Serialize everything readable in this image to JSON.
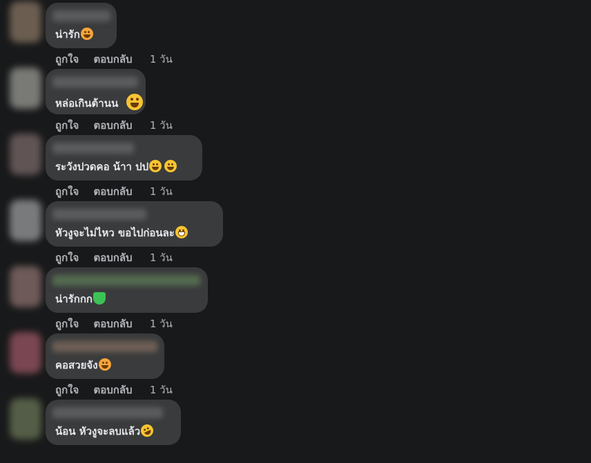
{
  "actions": {
    "like": "ถูกใจ",
    "reply": "ตอบกลับ"
  },
  "comments": [
    {
      "text": "น่ารัก",
      "time": "1 วัน",
      "emoji": "smiling-face-with-hearts-icon",
      "avatar_color": "#7a6a5a"
    },
    {
      "text": "หล่อเกินต้านน",
      "time": "1 วัน",
      "emoji": "grinning-squinting-face-icon",
      "avatar_color": "#8a8a86"
    },
    {
      "text": "ระวังปวดคอ น้าา ปป",
      "time": "1 วัน",
      "emoji": "grinning-sweat-face-icon",
      "avatar_color": "#6e5f5f"
    },
    {
      "text": "หัวงูจะไม่ไหว ขอไปก่อนละ",
      "time": "1 วัน",
      "emoji": "grimacing-face-icon",
      "avatar_color": "#8a8c8e"
    },
    {
      "text": "น่ารักกก",
      "time": "1 วัน",
      "emoji": "green-heart-icon",
      "avatar_color": "#7d6664"
    },
    {
      "text": "คอสวยจัง",
      "time": "1 วัน",
      "emoji": "smiling-face-with-hearts-icon",
      "avatar_color": "#8b4f5c"
    },
    {
      "text": "น้อน หัวงูจะลบแล้ว",
      "time": "",
      "emoji": "rolling-on-floor-laughing-icon",
      "avatar_color": "#5f6a4f"
    }
  ]
}
